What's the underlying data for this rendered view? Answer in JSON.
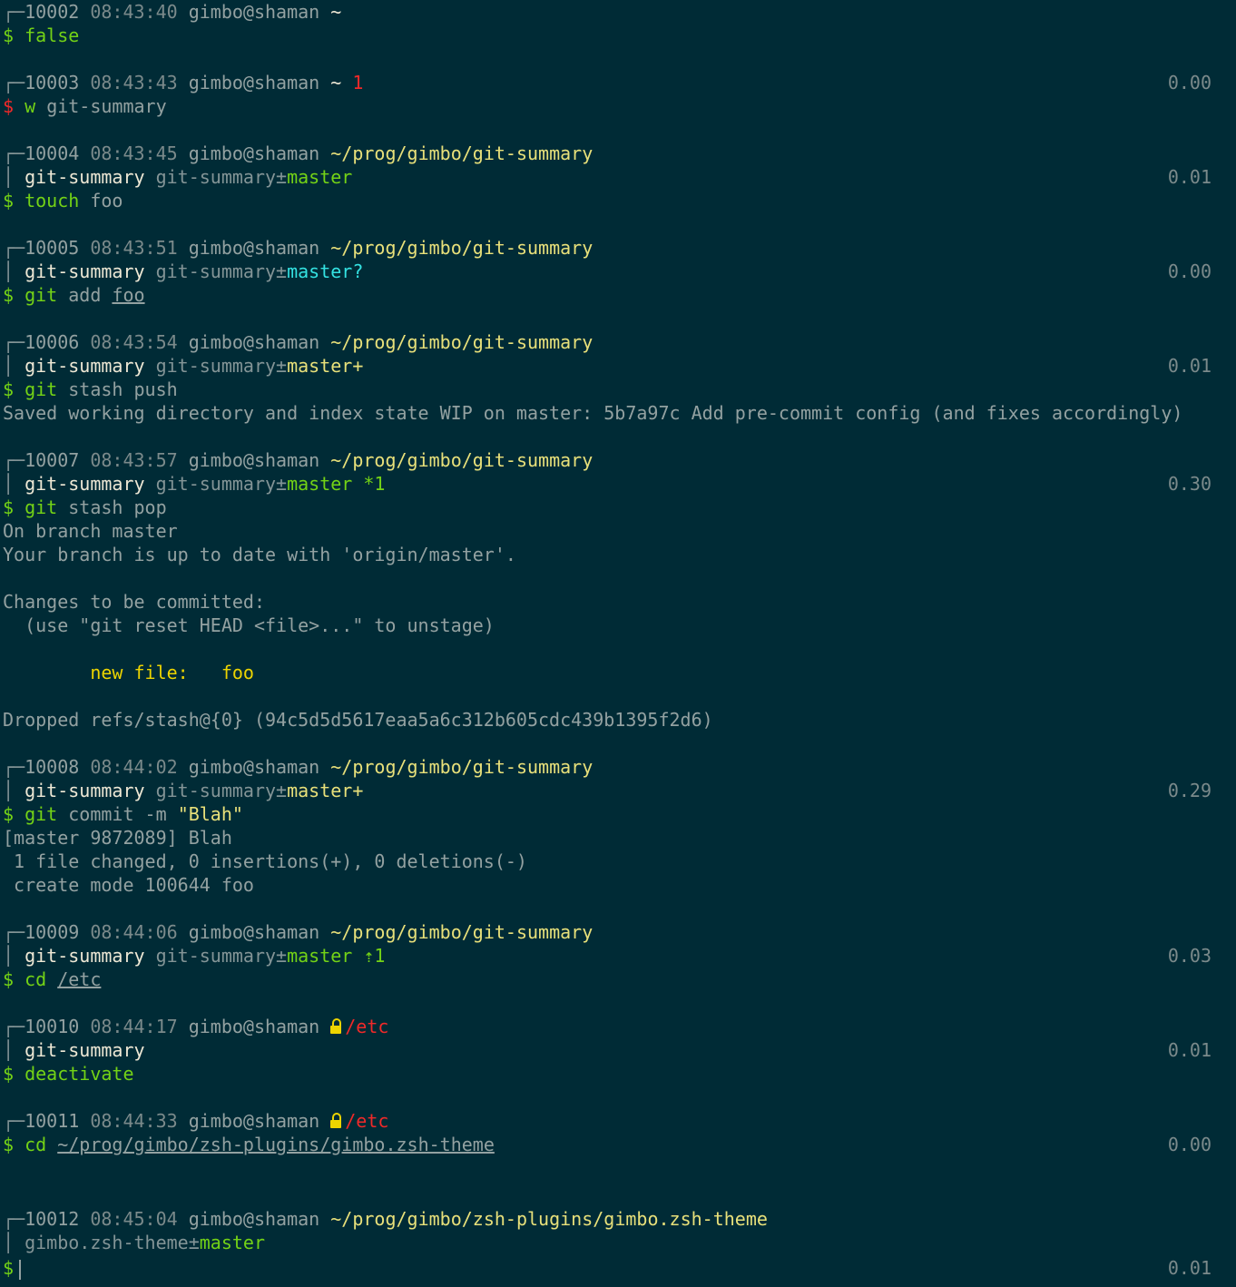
{
  "window": {
    "colors": {
      "background": "#002b36",
      "text": "#93a1a1",
      "bright": "#eee8d5",
      "path": "#e8e07a",
      "green": "#73d216",
      "cyan": "#34e2e2",
      "red": "#ef2929",
      "amber": "#edd400",
      "dim": "#7b8a8b"
    }
  },
  "terminal": {
    "lines": [
      {
        "segments": [
          {
            "t": "┌─",
            "c": "dim"
          },
          {
            "t": "10002 ",
            "c": "default"
          },
          {
            "t": "08:43:40 ",
            "c": "time"
          },
          {
            "t": "gimbo@shaman ",
            "c": "default"
          },
          {
            "t": "~",
            "c": "bright"
          }
        ]
      },
      {
        "segments": [
          {
            "t": "$ ",
            "c": "green"
          },
          {
            "t": "false",
            "c": "green"
          }
        ]
      },
      {
        "segments": []
      },
      {
        "segments": [
          {
            "t": "┌─",
            "c": "dim"
          },
          {
            "t": "10003 ",
            "c": "default"
          },
          {
            "t": "08:43:43 ",
            "c": "time"
          },
          {
            "t": "gimbo@shaman ",
            "c": "default"
          },
          {
            "t": "~ ",
            "c": "bright"
          },
          {
            "t": "1",
            "c": "red"
          }
        ],
        "rtime": "0.00"
      },
      {
        "segments": [
          {
            "t": "$ ",
            "c": "red"
          },
          {
            "t": "w ",
            "c": "green"
          },
          {
            "t": "git-summary",
            "c": "default"
          }
        ]
      },
      {
        "segments": []
      },
      {
        "segments": [
          {
            "t": "┌─",
            "c": "dim"
          },
          {
            "t": "10004 ",
            "c": "default"
          },
          {
            "t": "08:43:45 ",
            "c": "time"
          },
          {
            "t": "gimbo@shaman ",
            "c": "default"
          },
          {
            "t": "~/prog/gimbo/git-summary",
            "c": "yellow"
          }
        ]
      },
      {
        "segments": [
          {
            "t": "│ ",
            "c": "dim"
          },
          {
            "t": "git-summary ",
            "c": "bright"
          },
          {
            "t": "git-summary±",
            "c": "dim"
          },
          {
            "t": "master",
            "c": "green"
          }
        ],
        "rtime": "0.01"
      },
      {
        "segments": [
          {
            "t": "$ ",
            "c": "green"
          },
          {
            "t": "touch ",
            "c": "green"
          },
          {
            "t": "foo",
            "c": "default"
          }
        ]
      },
      {
        "segments": []
      },
      {
        "segments": [
          {
            "t": "┌─",
            "c": "dim"
          },
          {
            "t": "10005 ",
            "c": "default"
          },
          {
            "t": "08:43:51 ",
            "c": "time"
          },
          {
            "t": "gimbo@shaman ",
            "c": "default"
          },
          {
            "t": "~/prog/gimbo/git-summary",
            "c": "yellow"
          }
        ]
      },
      {
        "segments": [
          {
            "t": "│ ",
            "c": "dim"
          },
          {
            "t": "git-summary ",
            "c": "bright"
          },
          {
            "t": "git-summary±",
            "c": "dim"
          },
          {
            "t": "master?",
            "c": "cyan"
          }
        ],
        "rtime": "0.00"
      },
      {
        "segments": [
          {
            "t": "$ ",
            "c": "green"
          },
          {
            "t": "git ",
            "c": "green"
          },
          {
            "t": "add ",
            "c": "default"
          },
          {
            "t": "foo",
            "c": "default",
            "u": true
          }
        ]
      },
      {
        "segments": []
      },
      {
        "segments": [
          {
            "t": "┌─",
            "c": "dim"
          },
          {
            "t": "10006 ",
            "c": "default"
          },
          {
            "t": "08:43:54 ",
            "c": "time"
          },
          {
            "t": "gimbo@shaman ",
            "c": "default"
          },
          {
            "t": "~/prog/gimbo/git-summary",
            "c": "yellow"
          }
        ]
      },
      {
        "segments": [
          {
            "t": "│ ",
            "c": "dim"
          },
          {
            "t": "git-summary ",
            "c": "bright"
          },
          {
            "t": "git-summary±",
            "c": "dim"
          },
          {
            "t": "master+",
            "c": "yellow"
          }
        ],
        "rtime": "0.01"
      },
      {
        "segments": [
          {
            "t": "$ ",
            "c": "green"
          },
          {
            "t": "git ",
            "c": "green"
          },
          {
            "t": "stash push",
            "c": "default"
          }
        ]
      },
      {
        "segments": [
          {
            "t": "Saved working directory and index state WIP on master: 5b7a97c Add pre-commit config (and fixes accordingly)",
            "c": "default"
          }
        ]
      },
      {
        "segments": []
      },
      {
        "segments": [
          {
            "t": "┌─",
            "c": "dim"
          },
          {
            "t": "10007 ",
            "c": "default"
          },
          {
            "t": "08:43:57 ",
            "c": "time"
          },
          {
            "t": "gimbo@shaman ",
            "c": "default"
          },
          {
            "t": "~/prog/gimbo/git-summary",
            "c": "yellow"
          }
        ]
      },
      {
        "segments": [
          {
            "t": "│ ",
            "c": "dim"
          },
          {
            "t": "git-summary ",
            "c": "bright"
          },
          {
            "t": "git-summary±",
            "c": "dim"
          },
          {
            "t": "master *1",
            "c": "green"
          }
        ],
        "rtime": "0.30"
      },
      {
        "segments": [
          {
            "t": "$ ",
            "c": "green"
          },
          {
            "t": "git ",
            "c": "green"
          },
          {
            "t": "stash pop",
            "c": "default"
          }
        ]
      },
      {
        "segments": [
          {
            "t": "On branch master",
            "c": "default"
          }
        ]
      },
      {
        "segments": [
          {
            "t": "Your branch is up to date with 'origin/master'.",
            "c": "default"
          }
        ]
      },
      {
        "segments": []
      },
      {
        "segments": [
          {
            "t": "Changes to be committed:",
            "c": "default"
          }
        ]
      },
      {
        "segments": [
          {
            "t": "  (use \"git reset HEAD <file>...\" to unstage)",
            "c": "default"
          }
        ]
      },
      {
        "segments": []
      },
      {
        "segments": [
          {
            "t": "        new file:   foo",
            "c": "amber"
          }
        ]
      },
      {
        "segments": []
      },
      {
        "segments": [
          {
            "t": "Dropped refs/stash@{0} (94c5d5d5617eaa5a6c312b605cdc439b1395f2d6)",
            "c": "default"
          }
        ]
      },
      {
        "segments": []
      },
      {
        "segments": [
          {
            "t": "┌─",
            "c": "dim"
          },
          {
            "t": "10008 ",
            "c": "default"
          },
          {
            "t": "08:44:02 ",
            "c": "time"
          },
          {
            "t": "gimbo@shaman ",
            "c": "default"
          },
          {
            "t": "~/prog/gimbo/git-summary",
            "c": "yellow"
          }
        ]
      },
      {
        "segments": [
          {
            "t": "│ ",
            "c": "dim"
          },
          {
            "t": "git-summary ",
            "c": "bright"
          },
          {
            "t": "git-summary±",
            "c": "dim"
          },
          {
            "t": "master+",
            "c": "yellow"
          }
        ],
        "rtime": "0.29"
      },
      {
        "segments": [
          {
            "t": "$ ",
            "c": "green"
          },
          {
            "t": "git ",
            "c": "green"
          },
          {
            "t": "commit -m ",
            "c": "default"
          },
          {
            "t": "\"Blah\"",
            "c": "yellow"
          }
        ]
      },
      {
        "segments": [
          {
            "t": "[master 9872089] Blah",
            "c": "default"
          }
        ]
      },
      {
        "segments": [
          {
            "t": " 1 file changed, 0 insertions(+), 0 deletions(-)",
            "c": "default"
          }
        ]
      },
      {
        "segments": [
          {
            "t": " create mode 100644 foo",
            "c": "default"
          }
        ]
      },
      {
        "segments": []
      },
      {
        "segments": [
          {
            "t": "┌─",
            "c": "dim"
          },
          {
            "t": "10009 ",
            "c": "default"
          },
          {
            "t": "08:44:06 ",
            "c": "time"
          },
          {
            "t": "gimbo@shaman ",
            "c": "default"
          },
          {
            "t": "~/prog/gimbo/git-summary",
            "c": "yellow"
          }
        ]
      },
      {
        "segments": [
          {
            "t": "│ ",
            "c": "dim"
          },
          {
            "t": "git-summary ",
            "c": "bright"
          },
          {
            "t": "git-summary±",
            "c": "dim"
          },
          {
            "t": "master ⇡1",
            "c": "green"
          }
        ],
        "rtime": "0.03"
      },
      {
        "segments": [
          {
            "t": "$ ",
            "c": "green"
          },
          {
            "t": "cd ",
            "c": "green"
          },
          {
            "t": "/etc",
            "c": "default",
            "u": true
          }
        ]
      },
      {
        "segments": []
      },
      {
        "segments": [
          {
            "t": "┌─",
            "c": "dim"
          },
          {
            "t": "10010 ",
            "c": "default"
          },
          {
            "t": "08:44:17 ",
            "c": "time"
          },
          {
            "t": "gimbo@shaman ",
            "c": "default"
          },
          {
            "icon": "lock-icon"
          },
          {
            "t": "/etc",
            "c": "red"
          }
        ]
      },
      {
        "segments": [
          {
            "t": "│ ",
            "c": "dim"
          },
          {
            "t": "git-summary",
            "c": "bright"
          }
        ],
        "rtime": "0.01"
      },
      {
        "segments": [
          {
            "t": "$ ",
            "c": "green"
          },
          {
            "t": "deactivate",
            "c": "green"
          }
        ]
      },
      {
        "segments": []
      },
      {
        "segments": [
          {
            "t": "┌─",
            "c": "dim"
          },
          {
            "t": "10011 ",
            "c": "default"
          },
          {
            "t": "08:44:33 ",
            "c": "time"
          },
          {
            "t": "gimbo@shaman ",
            "c": "default"
          },
          {
            "icon": "lock-icon"
          },
          {
            "t": "/etc",
            "c": "red"
          }
        ]
      },
      {
        "segments": [
          {
            "t": "$ ",
            "c": "green"
          },
          {
            "t": "cd ",
            "c": "green"
          },
          {
            "t": "~/prog/gimbo/zsh-plugins/gimbo.zsh-theme",
            "c": "default",
            "u": true
          }
        ],
        "rtime": "0.00"
      },
      {
        "segments": []
      },
      {
        "segments": [],
        "tall": true
      },
      {
        "segments": [
          {
            "t": "┌─",
            "c": "dim"
          },
          {
            "t": "10012 ",
            "c": "default"
          },
          {
            "t": "08:45:04 ",
            "c": "time"
          },
          {
            "t": "gimbo@shaman ",
            "c": "default"
          },
          {
            "t": "~/prog/gimbo/zsh-plugins/gimbo.zsh-theme",
            "c": "yellow"
          }
        ]
      },
      {
        "segments": [
          {
            "t": "│ ",
            "c": "dim"
          },
          {
            "t": "gimbo.zsh-theme±",
            "c": "dim"
          },
          {
            "t": "master",
            "c": "green"
          }
        ]
      },
      {
        "segments": [
          {
            "t": "$",
            "c": "green"
          },
          {
            "cursor": true
          }
        ],
        "rtime": "0.01",
        "tall": true
      }
    ]
  }
}
